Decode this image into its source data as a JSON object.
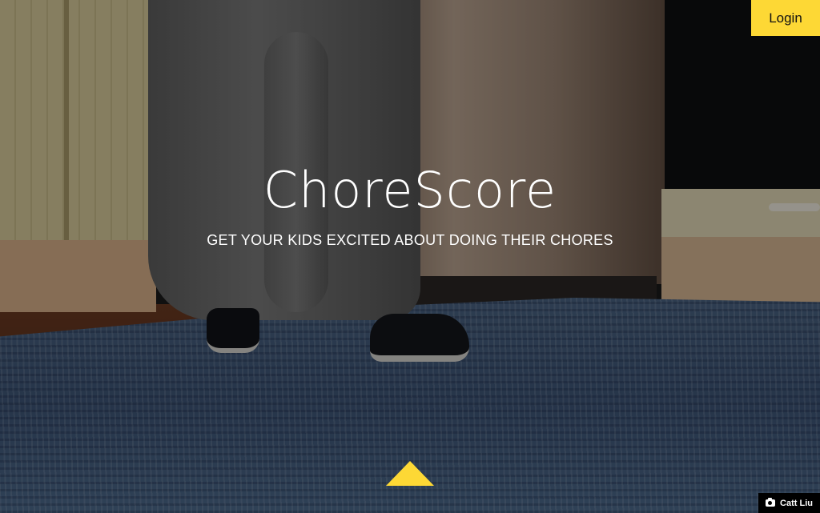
{
  "header": {
    "login_label": "Login"
  },
  "hero": {
    "title": "ChoreScore",
    "tagline": "GET YOUR KIDS EXCITED ABOUT DOING THEIR CHORES",
    "scroll_icon": "triangle-up-icon"
  },
  "photo_credit": {
    "icon": "camera-icon",
    "author": "Catt Liu"
  },
  "colors": {
    "accent": "#fdd835",
    "text": "#ffffff",
    "credit_bg": "#000000"
  }
}
